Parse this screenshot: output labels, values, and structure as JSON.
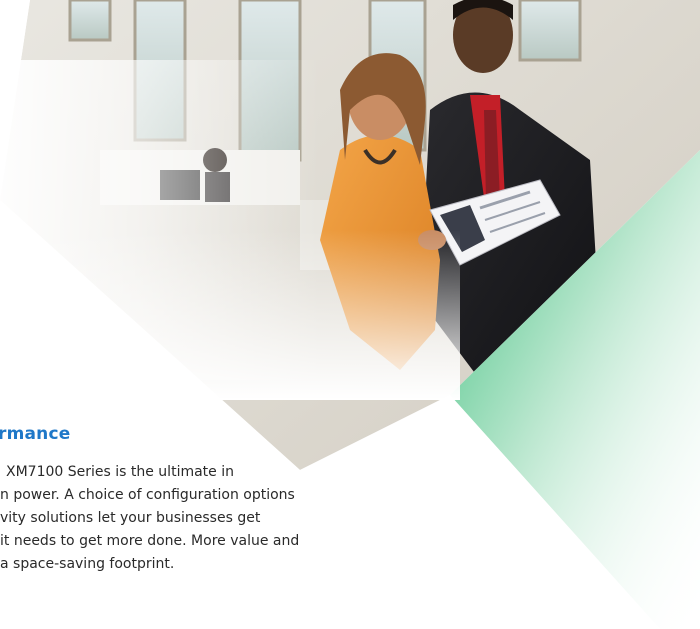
{
  "image": {
    "description": "",
    "alt": ""
  },
  "heading": "rmance",
  "body_lines": [
    "XM7100 Series is the ultimate in",
    "n power. A choice of configuration options",
    "vity solutions let your businesses get",
    " it needs to get more done. More value and",
    "a space-saving footprint."
  ],
  "colors": {
    "heading": "#1f78c8",
    "body": "#2a2a2a",
    "accent_green": "#3dbf7e"
  }
}
